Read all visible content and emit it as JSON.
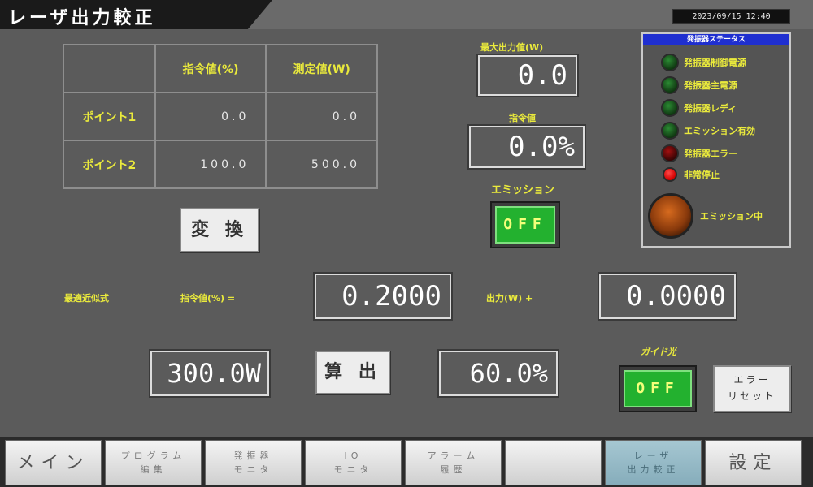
{
  "title": "レーザ出力較正",
  "datetime": "2023/09/15 12:40",
  "table": {
    "headers": [
      "",
      "指令値(%)",
      "測定値(W)"
    ],
    "rows": [
      {
        "label": "ポイント1",
        "command": "0.0",
        "measured": "0.0"
      },
      {
        "label": "ポイント2",
        "command": "100.0",
        "measured": "500.0"
      }
    ]
  },
  "convert_button": "変 換",
  "avg_output_label": "最大出力値(W)",
  "avg_output_value": "0.0",
  "command_label": "指令値",
  "command_value": "0.0%",
  "emission_label": "エミッション",
  "emission_toggle": "OFF",
  "formula": {
    "label": "最適近似式",
    "left_label": "指令値(%) =",
    "coef": "0.2000",
    "right_label": "出力(W) +",
    "offset": "0.0000"
  },
  "watt_input": "300.0W",
  "calc_button": "算 出",
  "percent_output": "60.0%",
  "guide_label": "ガイド光",
  "guide_toggle": "OFF",
  "error_reset": [
    "エラー",
    "リセット"
  ],
  "status_panel": {
    "header": "発振器ステータス",
    "items": [
      {
        "label": "発振器制御電源",
        "lamp": "green"
      },
      {
        "label": "発振器主電源",
        "lamp": "green"
      },
      {
        "label": "発振器レディ",
        "lamp": "green"
      },
      {
        "label": "エミッション有効",
        "lamp": "green"
      },
      {
        "label": "発振器エラー",
        "lamp": "dark-red"
      },
      {
        "label": "非常停止",
        "lamp": "red"
      }
    ],
    "emission_label": "エミッション中"
  },
  "nav": [
    {
      "lines": [
        "メイン"
      ],
      "big": true,
      "active": false
    },
    {
      "lines": [
        "プログラム",
        "編集"
      ],
      "big": false,
      "active": false
    },
    {
      "lines": [
        "発振器",
        "モニタ"
      ],
      "big": false,
      "active": false
    },
    {
      "lines": [
        "IO",
        "モニタ"
      ],
      "big": false,
      "active": false
    },
    {
      "lines": [
        "アラーム",
        "履歴"
      ],
      "big": false,
      "active": false
    },
    {
      "lines": [
        ""
      ],
      "big": false,
      "active": false
    },
    {
      "lines": [
        "レーザ",
        "出力較正"
      ],
      "big": false,
      "active": true
    },
    {
      "lines": [
        "設定"
      ],
      "big": true,
      "active": false
    }
  ]
}
